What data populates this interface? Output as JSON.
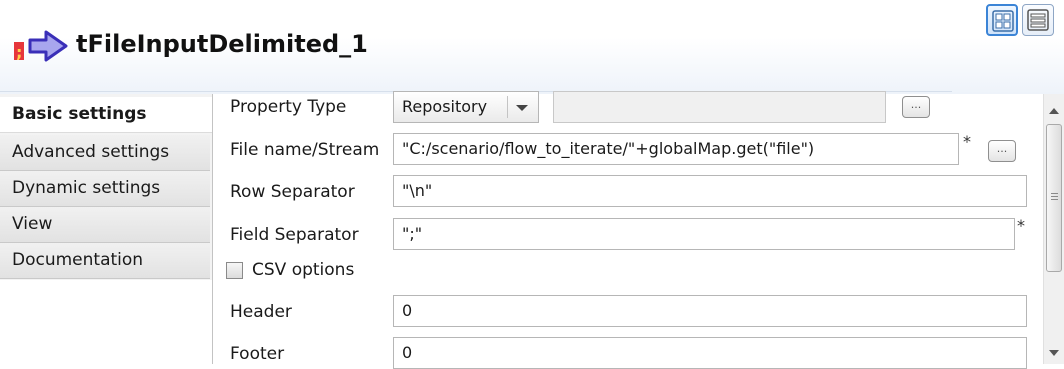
{
  "header": {
    "title": "tFileInputDelimited_1",
    "icon": "file-input-arrow-icon",
    "view_buttons": [
      "grid-view-icon",
      "list-view-icon"
    ]
  },
  "tabs": [
    {
      "label": "Basic settings",
      "active": true
    },
    {
      "label": "Advanced settings",
      "active": false
    },
    {
      "label": "Dynamic settings",
      "active": false
    },
    {
      "label": "View",
      "active": false
    },
    {
      "label": "Documentation",
      "active": false
    }
  ],
  "form": {
    "property_type": {
      "label": "Property Type",
      "value": "Repository",
      "repo_value": ""
    },
    "file_name": {
      "label": "File name/Stream",
      "value": "\"C:/scenario/flow_to_iterate/\"+globalMap.get(\"file\")",
      "required_mark": "*"
    },
    "row_separator": {
      "label": "Row Separator",
      "value": "\"\\n\""
    },
    "field_separator": {
      "label": "Field Separator",
      "value": "\";\"",
      "required_mark": "*"
    },
    "csv_options": {
      "label": "CSV options",
      "checked": false
    },
    "header": {
      "label": "Header",
      "value": "0"
    },
    "footer": {
      "label": "Footer",
      "value": "0"
    }
  },
  "dots_label": "...",
  "colors": {
    "accent": "#3b84d6",
    "tab_active_bg": "#ffffff"
  }
}
